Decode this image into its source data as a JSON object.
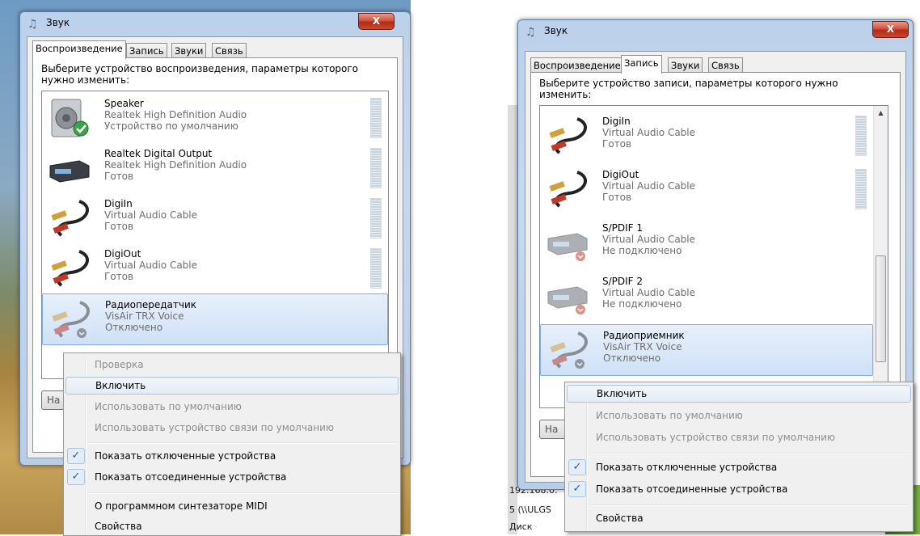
{
  "background": {
    "texts": [
      "192.168.0.",
      "5 (\\\\ULGS",
      "Диск"
    ]
  },
  "left": {
    "title": "Звук",
    "close_label": "X",
    "tabs": [
      "Воспроизведение",
      "Запись",
      "Звуки",
      "Связь"
    ],
    "active_tab": "Воспроизведение",
    "prompt": "Выберите устройство воспроизведения, параметры которого нужно изменить:",
    "devices": [
      {
        "name": "Speaker",
        "driver": "Realtek High Definition Audio",
        "status": "Устройство по умолчанию",
        "icon": "speaker-icon"
      },
      {
        "name": "Realtek Digital Output",
        "driver": "Realtek High Definition Audio",
        "status": "Готов",
        "icon": "digital-output-icon"
      },
      {
        "name": "DigiIn",
        "driver": "Virtual Audio Cable",
        "status": "Готов",
        "icon": "audio-cable-icon"
      },
      {
        "name": "DigiOut",
        "driver": "Virtual Audio Cable",
        "status": "Готов",
        "icon": "audio-cable-icon"
      },
      {
        "name": "Радиопередатчик",
        "driver": "VisAir TRX Voice",
        "status": "Отключено",
        "icon": "audio-cable-icon"
      }
    ],
    "partial_button": "На",
    "menu": [
      {
        "label": "Проверка",
        "disabled": true
      },
      {
        "label": "Включить",
        "hover": true
      },
      {
        "label": "Использовать по умолчанию",
        "disabled": true
      },
      {
        "label": "Использовать устройство связи по умолчанию",
        "disabled": true
      },
      {
        "label": "Показать отключенные устройства",
        "checked": true
      },
      {
        "label": "Показать отсоединенные устройства",
        "checked": true
      },
      {
        "label": "О программном синтезаторе MIDI"
      },
      {
        "label": "Свойства"
      }
    ]
  },
  "right": {
    "title": "Звук",
    "close_label": "X",
    "tabs": [
      "Воспроизведение",
      "Запись",
      "Звуки",
      "Связь"
    ],
    "active_tab": "Запись",
    "prompt": "Выберите устройство записи, параметры которого нужно изменить:",
    "devices": [
      {
        "name": "DigiIn",
        "driver": "Virtual Audio Cable",
        "status": "Готов",
        "icon": "audio-cable-icon"
      },
      {
        "name": "DigiOut",
        "driver": "Virtual Audio Cable",
        "status": "Готов",
        "icon": "audio-cable-icon"
      },
      {
        "name": "S/PDIF 1",
        "driver": "Virtual Audio Cable",
        "status": "Не подключено",
        "icon": "spdif-icon"
      },
      {
        "name": "S/PDIF 2",
        "driver": "Virtual Audio Cable",
        "status": "Не подключено",
        "icon": "spdif-icon"
      },
      {
        "name": "Радиоприемник",
        "driver": "VisAir TRX Voice",
        "status": "Отключено",
        "icon": "audio-cable-icon"
      }
    ],
    "partial_button": "На",
    "menu": [
      {
        "label": "Включить",
        "hover": true
      },
      {
        "label": "Использовать по умолчанию",
        "disabled": true
      },
      {
        "label": "Использовать устройство связи по умолчанию",
        "disabled": true
      },
      {
        "label": "Показать отключенные устройства",
        "checked": true
      },
      {
        "label": "Показать отсоединенные устройства",
        "checked": true
      },
      {
        "label": "Свойства"
      }
    ]
  }
}
